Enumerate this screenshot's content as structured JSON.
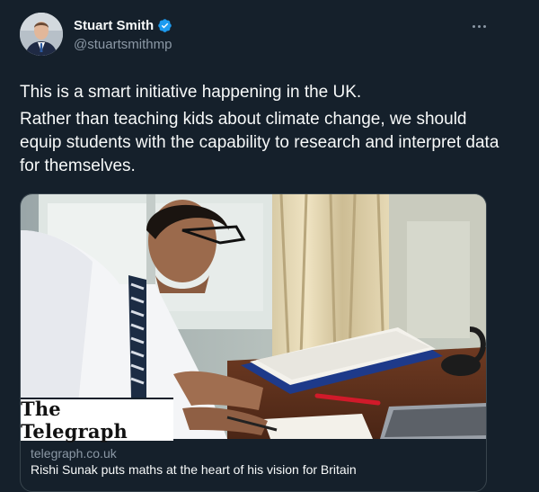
{
  "author": {
    "display_name": "Stuart Smith",
    "handle": "@stuartsmithmp",
    "verified": true
  },
  "tweet": {
    "paragraph_1": "This is a smart initiative happening in the UK.",
    "paragraph_2": "Rather than teaching kids about climate change, we should equip students with the capability to research and interpret data for themselves."
  },
  "link_card": {
    "source_logo_text": "The Telegraph",
    "domain": "telegraph.co.uk",
    "title": "Rishi Sunak puts maths at the heart of his vision for Britain"
  },
  "colors": {
    "background": "#15202b",
    "text_primary": "#f7f9f9",
    "text_secondary": "#8b98a5",
    "verified_badge": "#1d9bf0",
    "card_border": "#38444d"
  },
  "icons": {
    "verified": "verified-badge-icon",
    "more": "more-options-icon"
  }
}
